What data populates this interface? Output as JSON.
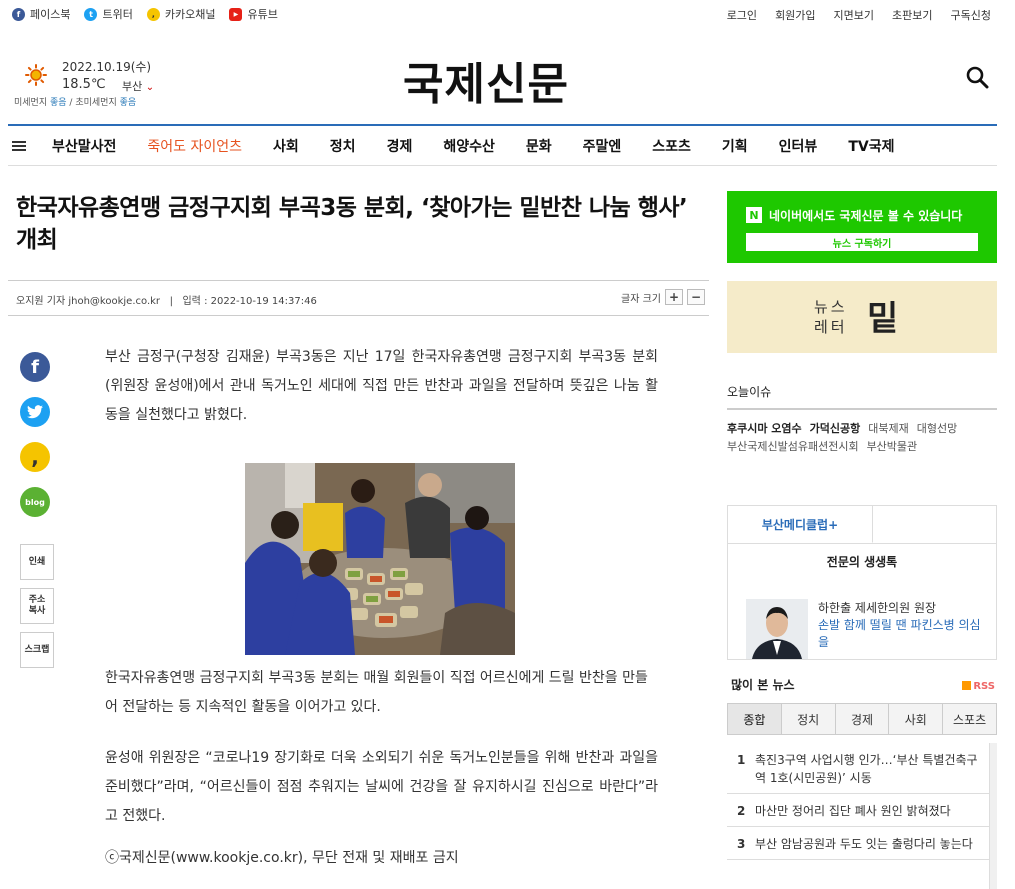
{
  "topbar": {
    "social": [
      {
        "label": "페이스북",
        "icon": "facebook-icon",
        "color": "#3b5998",
        "glyph": "f"
      },
      {
        "label": "트위터",
        "icon": "twitter-icon",
        "color": "#1da1f2",
        "glyph": "t"
      },
      {
        "label": "카카오채널",
        "icon": "kakao-icon",
        "color": "#f5c400",
        "glyph": ","
      },
      {
        "label": "유튜브",
        "icon": "youtube-icon",
        "color": "#e62117",
        "glyph": "▶"
      }
    ],
    "links": [
      "로그인",
      "회원가입",
      "지면보기",
      "초판보기",
      "구독신청"
    ]
  },
  "weather": {
    "date": "2022.10.19(수)",
    "temp": "18.5℃",
    "city": "부산",
    "dust_label": "미세먼지",
    "dust_value": "좋음",
    "ultra_label": "초미세먼지",
    "ultra_value": "좋음"
  },
  "logo": "국제신문",
  "nav": [
    "부산말사전",
    "죽어도 자이언츠",
    "사회",
    "정치",
    "경제",
    "해양수산",
    "문화",
    "주말엔",
    "스포츠",
    "기획",
    "인터뷰",
    "TV국제"
  ],
  "article": {
    "title": "한국자유총연맹 금정구지회 부곡3동 분회, ‘찾아가는 밑반찬 나눔 행사’ 개최",
    "byline": "오지원 기자 jhoh@kookje.co.kr",
    "date_label": "입력 : 2022-10-19 14:37:46",
    "fontsize_label": "글자 크기",
    "p1": "부산 금정구(구청장 김재윤) 부곡3동은 지난 17일 한국자유총연맹 금정구지회 부곡3동 분회(위원장 윤성애)에서 관내 독거노인 세대에 직접 만든 반찬과 과일을 전달하며 뜻깊은 나눔 활동을 실천했다고 밝혔다.",
    "p2": "한국자유총연맹 금정구지회 부곡3동 분회는 매월 회원들이 직접 어르신에게 드릴 반찬을 만들어 전달하는 등 지속적인 활동을 이어가고 있다.",
    "p3": "윤성애 위원장은 “코로나19 장기화로 더욱 소외되기 쉬운 독거노인분들을 위해 반찬과 과일을 준비했다”라며, “어르신들이 점점 추워지는 날씨에 건강을 잘 유지하시길 진심으로 바란다”라고 전했다.",
    "copyright": "ⓒ국제신문(www.kookje.co.kr), 무단 전재 및 재배포 금지"
  },
  "share": {
    "blog": "blog",
    "tools": [
      "인쇄",
      "주소\n복사",
      "스크랩"
    ]
  },
  "naver": {
    "badge": "N",
    "text": "네이버에서도 국제신문 볼 수 있습니다",
    "button": "뉴스 구독하기"
  },
  "newsletter": {
    "text": "뉴스\n레터",
    "brand": "밑"
  },
  "today_issue": {
    "title": "오늘이슈",
    "items": [
      {
        "t": "후쿠시마 오염수",
        "b": true
      },
      {
        "t": "가덕신공항",
        "b": true
      },
      {
        "t": "대북제재",
        "b": false
      },
      {
        "t": "대형선망",
        "b": false
      },
      {
        "t": "부산국제신발섬유패션전시회",
        "b": false
      },
      {
        "t": "부산박물관",
        "b": false
      }
    ]
  },
  "medi": {
    "tab": "부산메디클럽+",
    "heading": "전문의 생생톡",
    "doctor": "하한출 제세한의원 원장",
    "headline": "손발 함께 떨릴 땐 파킨스병 의심을"
  },
  "most_viewed": {
    "title": "많이 본 뉴스",
    "rss": "RSS",
    "tabs": [
      "종합",
      "정치",
      "경제",
      "사회",
      "스포츠"
    ],
    "items": [
      {
        "n": "1",
        "t": "촉진3구역 사업시행 인가…‘부산 특별건축구역 1호(시민공원)’ 시동"
      },
      {
        "n": "2",
        "t": "마산만 정어리 집단 폐사 원인 밝혀졌다"
      },
      {
        "n": "3",
        "t": "부산 암남공원과 두도 잇는 출렁다리 놓는다"
      }
    ]
  }
}
